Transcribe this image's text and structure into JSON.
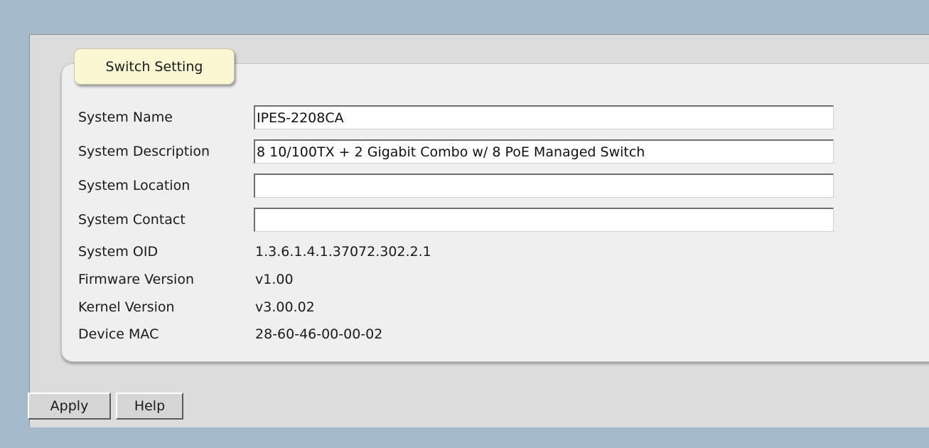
{
  "section": {
    "title": "Switch Setting"
  },
  "fields": [
    {
      "label": "System Name",
      "value": "IPES-2208CA"
    },
    {
      "label": "System Description",
      "value": "8 10/100TX + 2 Gigabit Combo w/ 8 PoE Managed Switch"
    },
    {
      "label": "System Location",
      "value": ""
    },
    {
      "label": "System Contact",
      "value": ""
    }
  ],
  "info": [
    {
      "label": "System OID",
      "value": "1.3.6.1.4.1.37072.302.2.1"
    },
    {
      "label": "Firmware Version",
      "value": "v1.00"
    },
    {
      "label": "Kernel Version",
      "value": "v3.00.02"
    },
    {
      "label": "Device MAC",
      "value": "28-60-46-00-00-02"
    }
  ],
  "buttons": {
    "apply": "Apply",
    "help": "Help"
  },
  "colors": {
    "background": "#a5bbcc",
    "panel": "#dcdcdc",
    "box": "#efefef",
    "tab": "#f9f8d2"
  }
}
